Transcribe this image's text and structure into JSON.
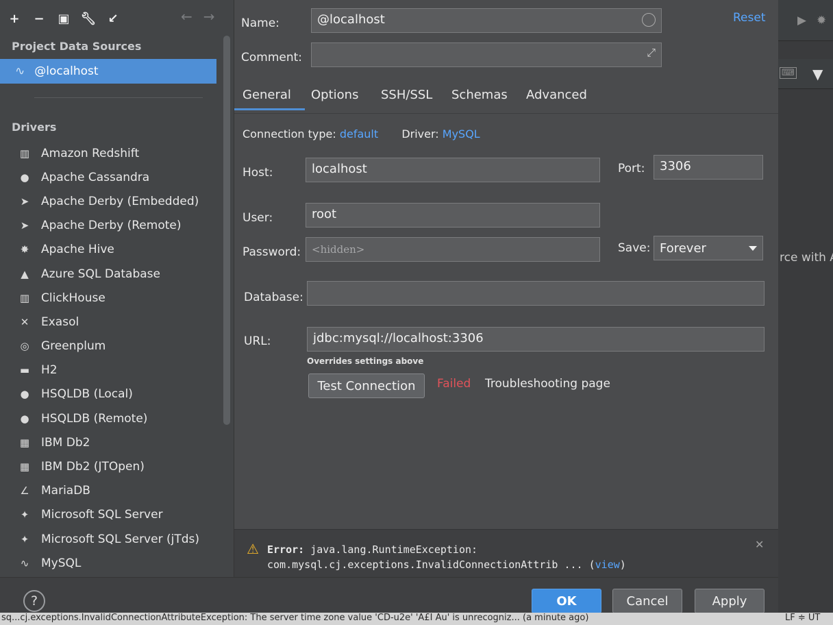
{
  "toolbar": {
    "icons": [
      "plus-icon",
      "minus-icon",
      "duplicate-icon",
      "wrench-icon",
      "import-icon"
    ]
  },
  "left": {
    "project_title": "Project Data Sources",
    "selected_source": "@localhost",
    "drivers_title": "Drivers",
    "drivers": [
      {
        "label": "Amazon Redshift",
        "icon": "▥"
      },
      {
        "label": "Apache Cassandra",
        "icon": "●"
      },
      {
        "label": "Apache Derby (Embedded)",
        "icon": "➤"
      },
      {
        "label": "Apache Derby (Remote)",
        "icon": "➤"
      },
      {
        "label": "Apache Hive",
        "icon": "✸"
      },
      {
        "label": "Azure SQL Database",
        "icon": "▲"
      },
      {
        "label": "ClickHouse",
        "icon": "▥"
      },
      {
        "label": "Exasol",
        "icon": "✕"
      },
      {
        "label": "Greenplum",
        "icon": "◎"
      },
      {
        "label": "H2",
        "icon": "▬"
      },
      {
        "label": "HSQLDB (Local)",
        "icon": "●"
      },
      {
        "label": "HSQLDB (Remote)",
        "icon": "●"
      },
      {
        "label": "IBM Db2",
        "icon": "▦"
      },
      {
        "label": "IBM Db2 (JTOpen)",
        "icon": "▦"
      },
      {
        "label": "MariaDB",
        "icon": "∠"
      },
      {
        "label": "Microsoft SQL Server",
        "icon": "✦"
      },
      {
        "label": "Microsoft SQL Server (jTds)",
        "icon": "✦"
      },
      {
        "label": "MySQL",
        "icon": "∿"
      }
    ]
  },
  "form": {
    "name_label": "Name:",
    "name_value": "@localhost",
    "comment_label": "Comment:",
    "comment_value": "",
    "reset_label": "Reset",
    "tabs": [
      "General",
      "Options",
      "SSH/SSL",
      "Schemas",
      "Advanced"
    ],
    "connection_type_label": "Connection type:",
    "connection_type_value": "default",
    "driver_label": "Driver:",
    "driver_value": "MySQL",
    "host_label": "Host:",
    "host_value": "localhost",
    "port_label": "Port:",
    "port_value": "3306",
    "user_label": "User:",
    "user_value": "root",
    "password_label": "Password:",
    "password_placeholder": "<hidden>",
    "save_label": "Save:",
    "save_value": "Forever",
    "database_label": "Database:",
    "database_value": "",
    "url_label": "URL:",
    "url_value": "jdbc:mysql://localhost:3306",
    "url_hint": "Overrides settings above",
    "test_button": "Test Connection",
    "test_status": "Failed",
    "troubleshooting": "Troubleshooting page"
  },
  "error": {
    "prefix": "Error:",
    "line1": "java.lang.RuntimeException:",
    "line2": "com.mysql.cj.exceptions.InvalidConnectionAttrib ... (",
    "view_link": "view",
    "line2_end": ")"
  },
  "buttons": {
    "help": "?",
    "ok": "OK",
    "cancel": "Cancel",
    "apply": "Apply"
  },
  "ide": {
    "partial_text": "rce with A",
    "status_message": "sq...cj.exceptions.InvalidConnectionAttributeException: The server time zone value 'CD-u2e' 'A£I Au' is unrecogniz... (a minute ago)",
    "status_right": "LF ≑ UT"
  }
}
